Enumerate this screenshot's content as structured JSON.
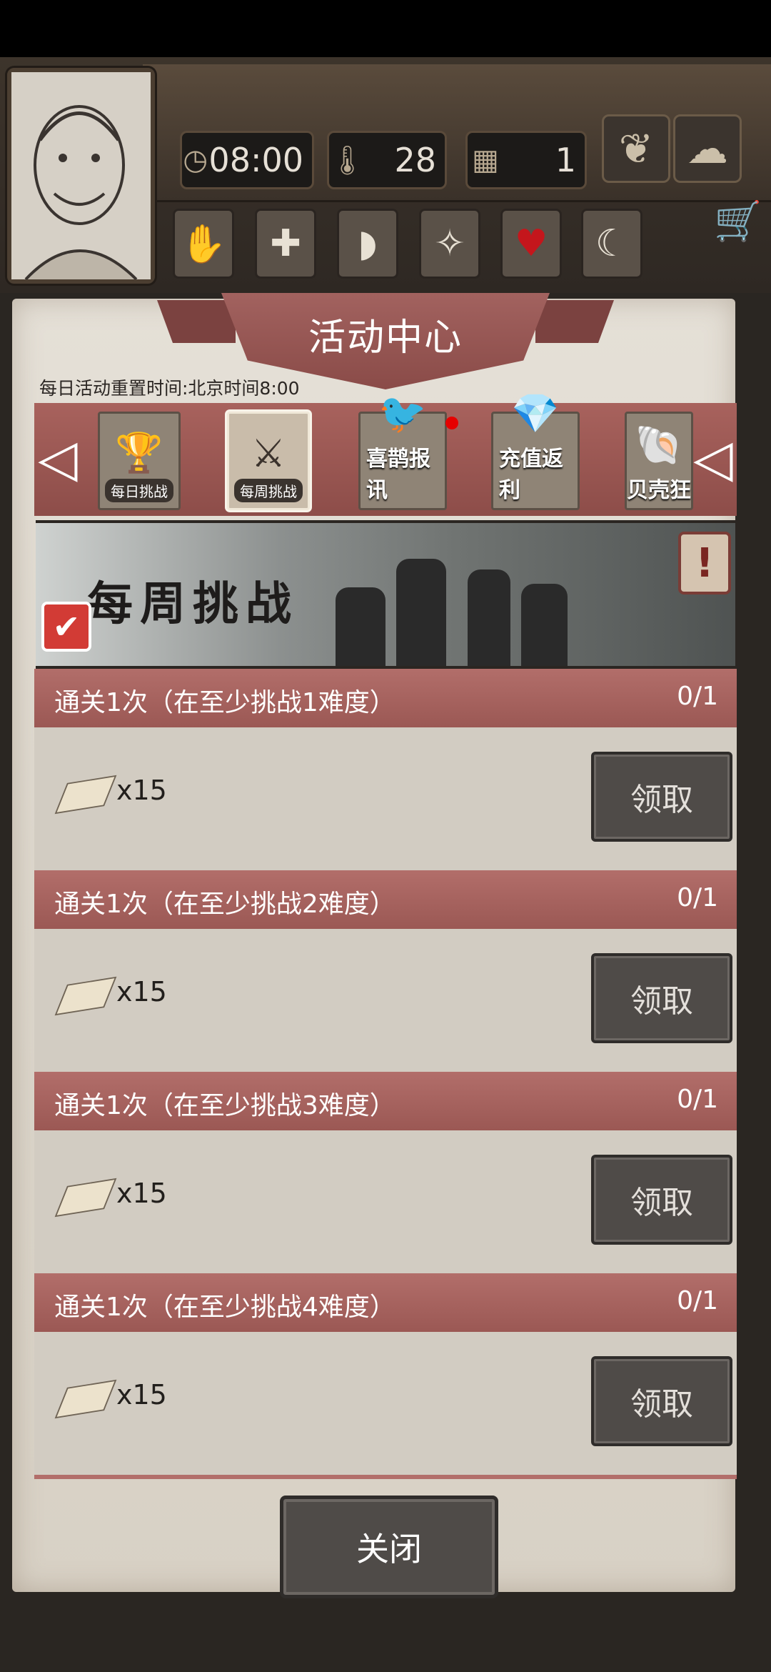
{
  "hud": {
    "time": "08:00",
    "temperature": "28",
    "day": "1",
    "time_icon": "clock-icon",
    "temperature_icon": "thermometer-icon",
    "day_icon": "calendar-icon",
    "season_icon": "maple-leaf-icon",
    "weather_icon": "cloud-icon",
    "cart_icon": "shopping-cart-icon",
    "status_icons": [
      "hand-icon",
      "health-cross-icon",
      "stomach-icon",
      "mind-icon",
      "heart-icon",
      "moon-icon"
    ]
  },
  "activity_center": {
    "title": "活动中心",
    "reset_note": "每日活动重置时间:北京时间8:00",
    "tabs": [
      {
        "label": "每日挑战",
        "icon": "trophy-icon",
        "active": false
      },
      {
        "label": "每周挑战",
        "icon": "crossed-swords-trophy-icon",
        "active": true
      },
      {
        "label": "喜鹊报讯",
        "icon": "magpie-icon",
        "active": false,
        "notification": true
      },
      {
        "label": "充值返利",
        "icon": "treasure-chest-icon",
        "active": false
      },
      {
        "label": "贝壳狂",
        "icon": "seashell-icon",
        "active": false
      }
    ],
    "banner_title": "每周挑战",
    "tasks": [
      {
        "title": "通关1次（在至少挑战1难度）",
        "progress": "0/1",
        "reward_qty": "x15",
        "claim": "领取"
      },
      {
        "title": "通关1次（在至少挑战2难度）",
        "progress": "0/1",
        "reward_qty": "x15",
        "claim": "领取"
      },
      {
        "title": "通关1次（在至少挑战3难度）",
        "progress": "0/1",
        "reward_qty": "x15",
        "claim": "领取"
      },
      {
        "title": "通关1次（在至少挑战4难度）",
        "progress": "0/1",
        "reward_qty": "x15",
        "claim": "领取"
      }
    ],
    "close_label": "关闭"
  },
  "colors": {
    "accent_red": "#9b5854",
    "panel": "#dcd6cb",
    "button_dark": "#4f4b48"
  }
}
